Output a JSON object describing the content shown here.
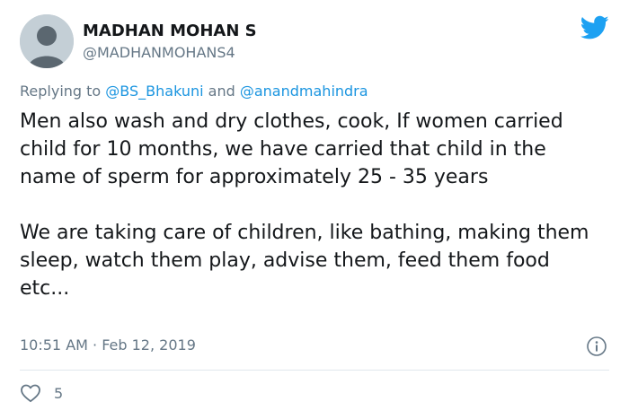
{
  "user": {
    "display_name": "MADHAN MOHAN S",
    "handle": "@MADHANMOHANS4"
  },
  "reply": {
    "prefix": "Replying to ",
    "mention_1": "@BS_Bhakuni",
    "conjunction": " and ",
    "mention_2": "@anandmahindra"
  },
  "tweet": {
    "paragraphs": [
      "Men also wash and dry clothes, cook, If women carried child for 10 months, we have carried that child in the name of sperm for approximately 25 - 35 years",
      "We are taking care of children, like bathing, making them sleep, watch them play, advise them, feed them food etc..."
    ],
    "timestamp": "10:51 AM · Feb 12, 2019"
  },
  "stats": {
    "likes": "5"
  },
  "icons": {
    "brand": "twitter-bird-icon",
    "info": "info-icon",
    "like": "heart-icon"
  },
  "colors": {
    "brand": "#1da1f2",
    "link": "#1b95e0",
    "muted": "#657786",
    "text": "#14171a"
  }
}
